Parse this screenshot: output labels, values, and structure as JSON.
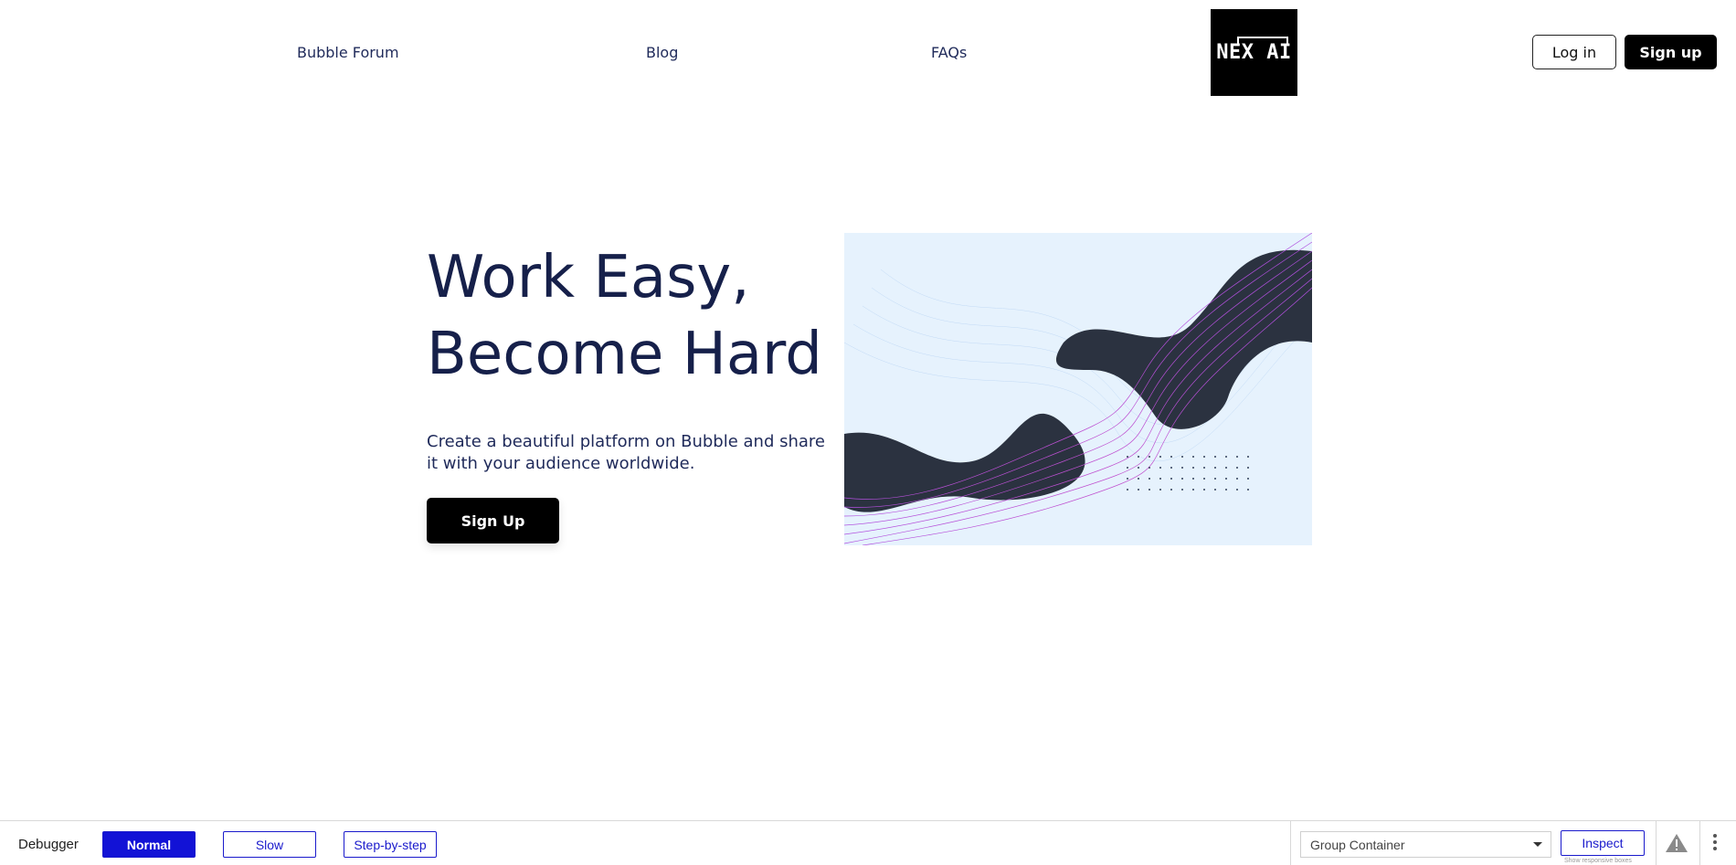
{
  "header": {
    "nav": [
      {
        "label": "Bubble Forum"
      },
      {
        "label": "Blog"
      },
      {
        "label": "FAQs"
      }
    ],
    "logo_text": "NEX AI",
    "login_label": "Log in",
    "signup_label": "Sign up"
  },
  "hero": {
    "title_line1": "Work Easy,",
    "title_line2": "Become Hard",
    "subtitle": "Create a beautiful platform on Bubble and share it with your audience worldwide.",
    "cta_label": "Sign Up"
  },
  "debugger": {
    "label": "Debugger",
    "modes": [
      {
        "label": "Normal",
        "active": true
      },
      {
        "label": "Slow",
        "active": false
      },
      {
        "label": "Step-by-step",
        "active": false
      }
    ],
    "element_select": "Group Container",
    "inspect_label": "Inspect",
    "responsive_hint": "Show responsive boxes"
  },
  "colors": {
    "heading": "#16204a",
    "debugger_accent": "#1212d6",
    "hero_bg": "#e6f2fd"
  }
}
